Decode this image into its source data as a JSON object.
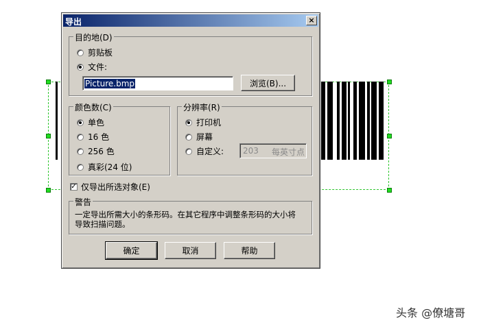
{
  "dialog": {
    "title": "导出",
    "close_glyph": "×"
  },
  "destination": {
    "legend": "目的地(D)",
    "clipboard_label": "剪贴板",
    "file_label": "文件:",
    "file_value": "Picture.bmp",
    "browse_label": "浏览(B)..."
  },
  "colors": {
    "legend": "颜色数(C)",
    "options": [
      "单色",
      "16 色",
      "256 色",
      "真彩(24 位)"
    ],
    "selected": "单色"
  },
  "resolution": {
    "legend": "分辨率(R)",
    "options": [
      "打印机",
      "屏幕",
      "自定义:"
    ],
    "selected": "打印机",
    "custom_value": "203",
    "custom_unit": "每英寸点"
  },
  "export_selected": {
    "label": "仅导出所选对象(E)",
    "checked": true
  },
  "warning": {
    "legend": "警告",
    "text": "一定导出所需大小的条形码。在其它程序中调整条形码的大小将导致扫描问题。"
  },
  "buttons": {
    "ok": "确定",
    "cancel": "取消",
    "help": "帮助"
  },
  "watermark": "头条 @僚塘哥"
}
